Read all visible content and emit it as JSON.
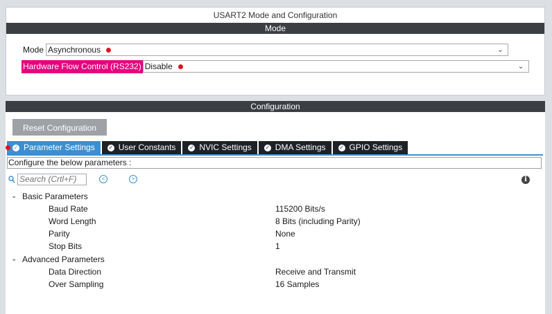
{
  "mode_panel": {
    "title": "USART2 Mode and Configuration",
    "band": "Mode",
    "mode_label": "Mode",
    "mode_value": "Asynchronous",
    "flow_label": "Hardware Flow Control (RS232)",
    "flow_value": "Disable"
  },
  "config_panel": {
    "band": "Configuration",
    "reset_label": "Reset Configuration",
    "tabs": [
      {
        "label": "Parameter Settings",
        "active": true
      },
      {
        "label": "User Constants"
      },
      {
        "label": "NVIC Settings"
      },
      {
        "label": "DMA Settings"
      },
      {
        "label": "GPIO Settings"
      }
    ],
    "hint": "Configure the below parameters :",
    "search_placeholder": "Search (Crtl+F)",
    "groups": [
      {
        "name": "Basic Parameters",
        "params": [
          {
            "name": "Baud Rate",
            "value": "115200 Bits/s"
          },
          {
            "name": "Word Length",
            "value": "8 Bits (including Parity)"
          },
          {
            "name": "Parity",
            "value": "None"
          },
          {
            "name": "Stop Bits",
            "value": "1"
          }
        ]
      },
      {
        "name": "Advanced Parameters",
        "params": [
          {
            "name": "Data Direction",
            "value": "Receive and Transmit"
          },
          {
            "name": "Over Sampling",
            "value": "16 Samples"
          }
        ]
      }
    ]
  },
  "colors": {
    "active_tab": "#3a8fd1",
    "inactive_tab": "#1e2126",
    "highlight_label": "#e6007e",
    "warning_dot": "#e0151b"
  }
}
